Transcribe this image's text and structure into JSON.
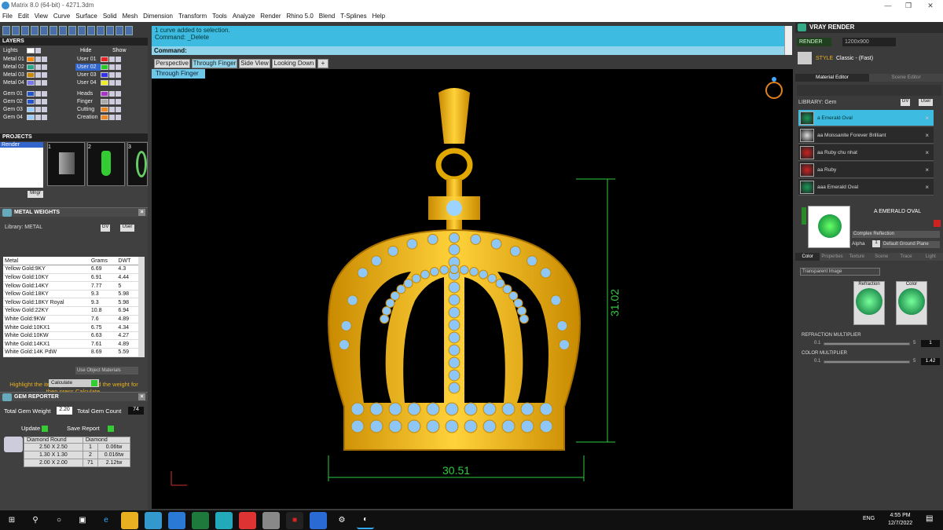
{
  "window": {
    "title": "Matrix 8.0 (64-bit) - 4271.3dm"
  },
  "menu": [
    "File",
    "Edit",
    "View",
    "Curve",
    "Surface",
    "Solid",
    "Mesh",
    "Dimension",
    "Transform",
    "Tools",
    "Analyze",
    "Render",
    "Rhino 5.0",
    "Blend",
    "T-Splines",
    "Help"
  ],
  "layers": {
    "title": "LAYERS",
    "lights": "Lights",
    "hide": "Hide",
    "show": "Show",
    "left": [
      "Metal 01",
      "Metal 02",
      "Metal 03",
      "Metal 04",
      "Gem 01",
      "Gem 02",
      "Gem 03",
      "Gem 04"
    ],
    "right": [
      "User 01",
      "User 02",
      "User 03",
      "User 04",
      "Heads",
      "Finger",
      "Cutting",
      "Creation"
    ]
  },
  "projects": {
    "title": "PROJECTS",
    "item": "Render",
    "thumbs": [
      "1",
      "2",
      "3"
    ],
    "mngr": "Mngr"
  },
  "metal_weights": {
    "title": "METAL WEIGHTS",
    "library": "Library: METAL",
    "gv": "GV",
    "user": "User",
    "headers": [
      "Metal",
      "Grams",
      "DWT"
    ],
    "rows": [
      [
        "Yellow Gold:9KY",
        "6.69",
        "4.3"
      ],
      [
        "Yellow Gold:10KY",
        "6.91",
        "4.44"
      ],
      [
        "Yellow Gold:14KY",
        "7.77",
        "5"
      ],
      [
        "Yellow Gold:18KY",
        "9.3",
        "5.98"
      ],
      [
        "Yellow Gold:18KY Royal",
        "9.3",
        "5.98"
      ],
      [
        "Yellow Gold:22KY",
        "10.8",
        "6.94"
      ],
      [
        "White Gold:9KW",
        "7.6",
        "4.89"
      ],
      [
        "White Gold:10KX1",
        "6.75",
        "4.34"
      ],
      [
        "White Gold:10KW",
        "6.63",
        "4.27"
      ],
      [
        "White Gold:14KX1",
        "7.61",
        "4.89"
      ],
      [
        "White Gold:14K PdW",
        "8.69",
        "5.59"
      ]
    ],
    "use_obj": "Use Object Materials",
    "hint": "Highlight the items you want to find the weight for then press Calculate.",
    "calculate": "Calculate"
  },
  "gem_reporter": {
    "title": "GEM REPORTER",
    "tgw_label": "Total Gem Weight",
    "tgw": "2.20",
    "tgc_label": "Total Gem Count",
    "tgc": "74",
    "update": "Update",
    "save": "Save Report",
    "headers": [
      "Diamond Round",
      "Diamond"
    ],
    "rows": [
      [
        "2.50 X 2.50",
        "1",
        "0.06tw"
      ],
      [
        "1.30 X 1.30",
        "2",
        "0.016tw"
      ],
      [
        "2.00 X 2.00",
        "71",
        "2.12tw"
      ]
    ]
  },
  "command": {
    "line1": "1 curve added to selection.",
    "line2": "Command: _Delete",
    "prompt": "Command:"
  },
  "viewport_tabs": [
    "Perspective",
    "Through Finger",
    "Side View",
    "Looking Down"
  ],
  "subtab": "Through Finger",
  "dimensions": {
    "height": "31.02",
    "width": "30.51"
  },
  "vray": {
    "title": "VRAY RENDER",
    "render": "RENDER",
    "size": "1200x900",
    "style": "STYLE",
    "style_val": "Classic - (Fast)",
    "mat_editor": "Material Editor",
    "scene_editor": "Scene Editor",
    "library": "LIBRARY: Gem",
    "gv": "GV",
    "user": "User",
    "items": [
      "a Emerald Oval",
      "aa Moissanite Forever Brilliant",
      "aa Ruby chu nhat",
      "aa Ruby",
      "aaa Emerald Oval"
    ],
    "selected_name": "A EMERALD OVAL",
    "complex": "Complex Reflection",
    "alpha": "Alpha",
    "alpha_val": "1",
    "ground": "Default Ground Plane",
    "tabs": [
      "Color",
      "Properties",
      "Texture",
      "Scene",
      "Trace",
      "Light"
    ],
    "transparent": "Transparent Image",
    "refraction": "Refraction",
    "color": "Color",
    "refr_mult": "REFRACTION MULTIPLIER",
    "refr_min": "0.1",
    "refr_max": "5",
    "refr_val": "1",
    "col_mult": "COLOR MULTIPLIER",
    "col_min": "0.1",
    "col_max": "5",
    "col_val": "1.42"
  },
  "taskbar": {
    "time": "4:55 PM",
    "date": "12/7/2022",
    "lang": "ENG"
  }
}
